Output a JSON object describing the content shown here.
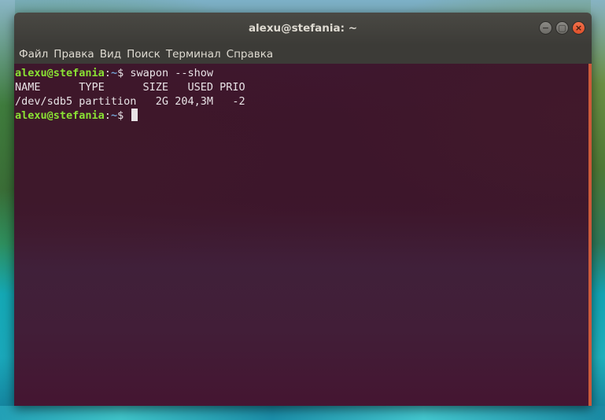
{
  "window": {
    "title": "alexu@stefania: ~",
    "controls": {
      "minimize": "−",
      "maximize": "▢",
      "close": "×"
    }
  },
  "menu": [
    "Файл",
    "Правка",
    "Вид",
    "Поиск",
    "Терминал",
    "Справка"
  ],
  "terminal": {
    "prompt_user_host": "alexu@stefania",
    "prompt_sep": ":",
    "prompt_path": "~",
    "prompt_symbol": "$ ",
    "command": "swapon --show",
    "output": [
      "NAME      TYPE      SIZE   USED PRIO",
      "/dev/sdb5 partition   2G 204,3M   -2"
    ]
  },
  "colors": {
    "prompt_user": "#8ae234",
    "prompt_path": "#729fcf",
    "terminal_bg": "#3d0f2a",
    "scrollbar": "#cc5a3a"
  }
}
